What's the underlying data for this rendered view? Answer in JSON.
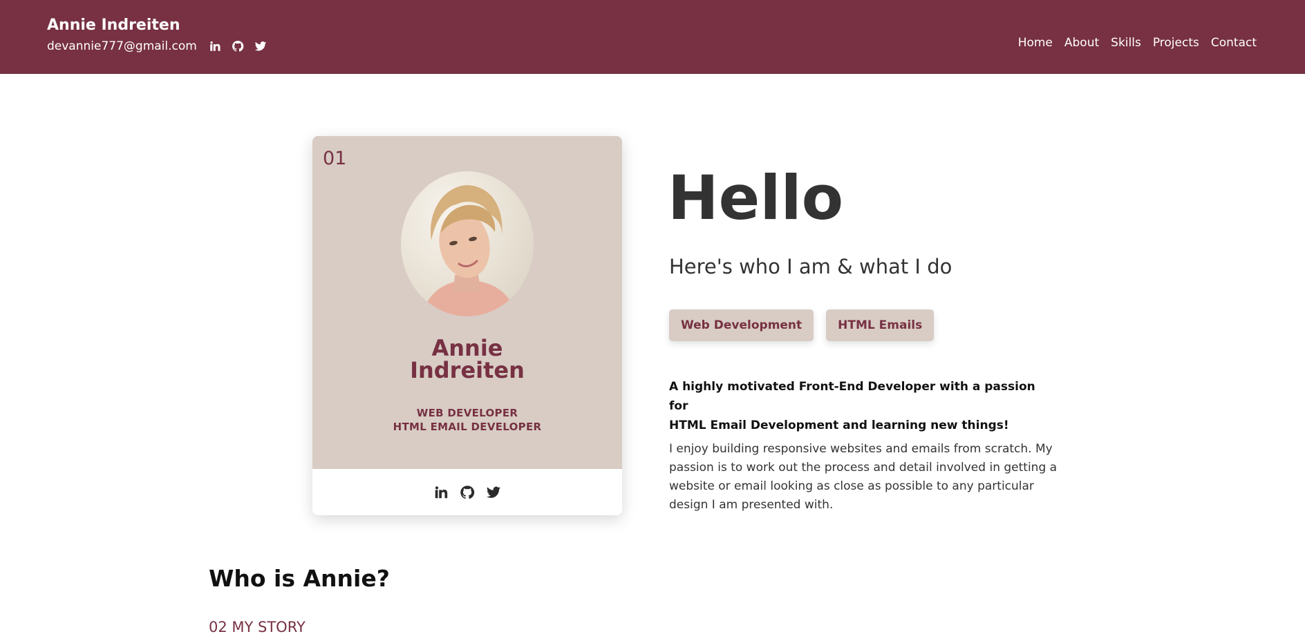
{
  "header": {
    "brand": "Annie Indreiten",
    "email": "devannie777@gmail.com",
    "social_icons": [
      "linkedin-icon",
      "github-icon",
      "twitter-icon"
    ],
    "nav": [
      "Home",
      "About",
      "Skills",
      "Projects",
      "Contact"
    ],
    "background": "#773142"
  },
  "card": {
    "number": "01",
    "name_line1": "Annie",
    "name_line2": "Indreiten",
    "role_line1": "WEB DEVELOPER",
    "role_line2": "HTML EMAIL DEVELOPER",
    "social_icons": [
      "linkedin-icon",
      "github-icon",
      "twitter-icon"
    ],
    "background": "#d8ccc5"
  },
  "hero": {
    "heading": "Hello",
    "subtitle": "Here's who I am & what I do",
    "tags": [
      "Web Development",
      "HTML Emails"
    ],
    "lead_line1": "A highly motivated Front-End Developer with a passion for",
    "lead_line2": "HTML Email Development and learning new things!",
    "body_line1": "I enjoy building responsive websites and emails from scratch. My",
    "body_line2": "passion is to work out the process and detail involved in getting a",
    "body_line3": "website or email looking as close as possible to any particular",
    "body_line4": "design I am presented with."
  },
  "about": {
    "heading": "Who is Annie?",
    "section_label": "02 MY STORY"
  },
  "colors": {
    "accent": "#773142",
    "card": "#d8ccc5",
    "text": "#333333"
  }
}
